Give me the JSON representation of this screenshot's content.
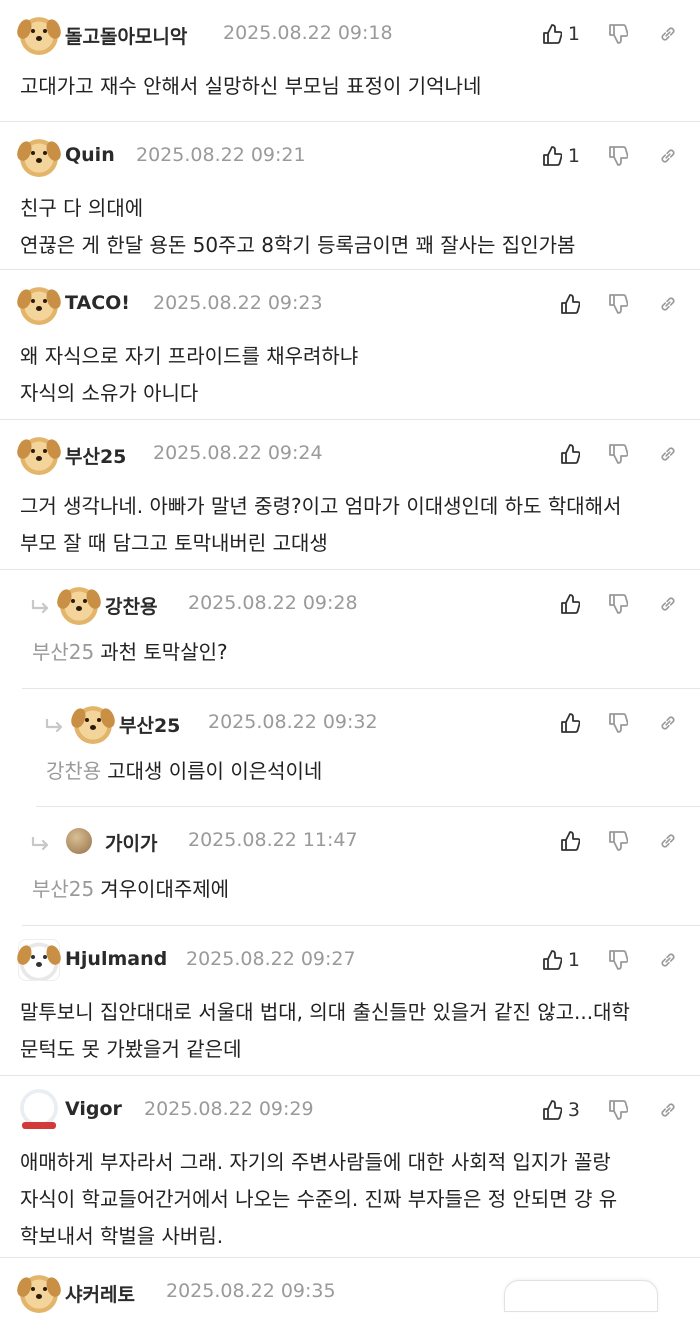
{
  "colors": {
    "nickname": "#2a2a2a",
    "date": "#9a9a9a",
    "divider": "#e6e6e6",
    "icon": "#8a8a8a",
    "icon_active": "#333333"
  },
  "comments": [
    {
      "nickname": "돌고돌아모니악",
      "date": "2025.08.22 09:18",
      "likes": "1",
      "avatar": "dog-avatar",
      "lines": [
        "고대가고 재수 안해서 실망하신 부모님 표정이 기억나네"
      ]
    },
    {
      "nickname": "Quin",
      "date": "2025.08.22 09:21",
      "likes": "1",
      "avatar": "dog-avatar",
      "lines": [
        "친구 다 의대에",
        "연끊은 게 한달 용돈 50주고 8학기 등록금이면 꽤 잘사는 집인가봄"
      ]
    },
    {
      "nickname": "TACO!",
      "date": "2025.08.22 09:23",
      "likes": "",
      "avatar": "dog-avatar",
      "lines": [
        "왜 자식으로 자기 프라이드를 채우려하냐",
        "자식의 소유가 아니다"
      ]
    },
    {
      "nickname": "부산25",
      "date": "2025.08.22 09:24",
      "likes": "",
      "avatar": "dog-avatar",
      "lines": [
        "그거 생각나네. 아빠가 말년 중령?이고 엄마가 이대생인데 하도 학대해서",
        "부모 잘 때 담그고 토막내버린 고대생"
      ]
    },
    {
      "nickname": "강찬용",
      "date": "2025.08.22 09:28",
      "likes": "",
      "avatar": "dog-avatar",
      "reply_to": "부산25",
      "lines": [
        "과천 토막살인?"
      ]
    },
    {
      "nickname": "부산25",
      "date": "2025.08.22 09:32",
      "likes": "",
      "avatar": "dog-avatar",
      "reply_to": "강찬용",
      "lines": [
        "고대생 이름이 이은석이네"
      ]
    },
    {
      "nickname": "가이가",
      "date": "2025.08.22 11:47",
      "likes": "",
      "avatar": "ball-avatar",
      "reply_to": "부산25",
      "lines": [
        "겨우이대주제에"
      ]
    },
    {
      "nickname": "Hjulmand",
      "date": "2025.08.22 09:27",
      "likes": "1",
      "avatar": "white-dog-avatar",
      "lines": [
        "말투보니 집안대대로 서울대 법대, 의대 출신들만 있을거 같진 않고...대학",
        "문턱도 못 가봤을거 같은데"
      ]
    },
    {
      "nickname": "Vigor",
      "date": "2025.08.22 09:29",
      "likes": "3",
      "avatar": "polar-bear-avatar",
      "lines": [
        "애매하게 부자라서 그래. 자기의 주변사람들에 대한 사회적 입지가 꼴랑",
        "자식이 학교들어간거에서 나오는 수준의. 진짜 부자들은 정 안되면 걍 유",
        "학보내서 학벌을 사버림."
      ]
    },
    {
      "nickname": "샤커레토",
      "date": "2025.08.22 09:35",
      "likes": "",
      "avatar": "dog-avatar",
      "lines": []
    }
  ]
}
